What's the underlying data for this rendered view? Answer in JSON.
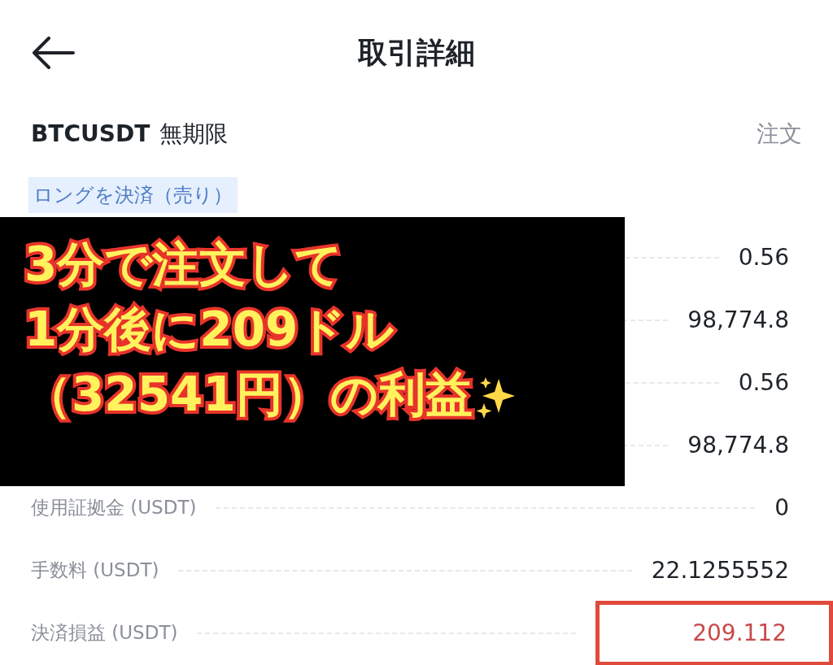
{
  "header": {
    "title": "取引詳細"
  },
  "instrument": {
    "symbol": "BTCUSDT",
    "contract": "無期限",
    "order_type": "注文"
  },
  "tag": "ロングを決済（売り）",
  "rows": [
    {
      "value": "0.56",
      "kind": "plain",
      "highlighted": false
    },
    {
      "value": "98,774.8",
      "kind": "plain",
      "highlighted": false
    },
    {
      "value": "0.56",
      "kind": "plain",
      "highlighted": false
    },
    {
      "value": "98,774.8",
      "kind": "plain",
      "highlighted": false
    },
    {
      "label": "使用証拠金 (USDT)",
      "value": "0",
      "kind": "plain",
      "highlighted": false
    },
    {
      "label": "手数料 (USDT)",
      "value": "22.1255552",
      "kind": "plain",
      "highlighted": false
    },
    {
      "label": "決済損益 (USDT)",
      "value": "209.112",
      "kind": "profit",
      "highlighted": true
    }
  ],
  "overlay": {
    "lines": [
      "3分で注文して",
      "1分後に209ドル",
      "（32541円）の利益"
    ]
  }
}
